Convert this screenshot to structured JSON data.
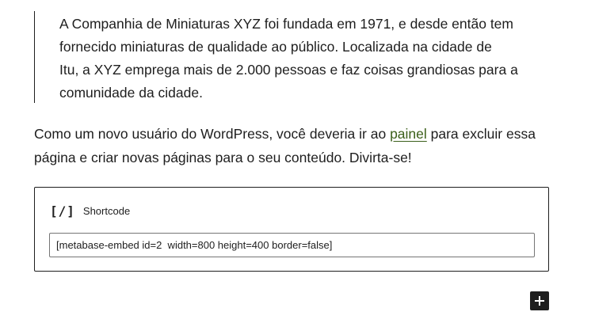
{
  "quote": {
    "lines": [
      "A Companhia de Miniaturas XYZ foi fundada em 1971, e desde então tem",
      "fornecido miniaturas de qualidade ao público. Localizada na cidade de",
      "Itu, a XYZ emprega mais de 2.000 pessoas e faz coisas grandiosas para a",
      "comunidade da cidade."
    ]
  },
  "paragraph": {
    "before_link": "Como um novo usuário do WordPress, você deveria ir ao ",
    "link_text": "painel",
    "after_link_line1": " para excluir essa",
    "line2": "página e criar novas páginas para o seu conteúdo. Divirta-se!"
  },
  "shortcode": {
    "icon_glyph": "[/]",
    "icon_name": "shortcode-icon",
    "title": "Shortcode",
    "value": "[metabase-embed id=2  width=800 height=400 border=false]"
  },
  "inserter": {
    "icon_name": "plus-icon"
  },
  "colors": {
    "text": "#1e1e1e",
    "link": "#3b5f1a",
    "input_border": "#757575"
  }
}
